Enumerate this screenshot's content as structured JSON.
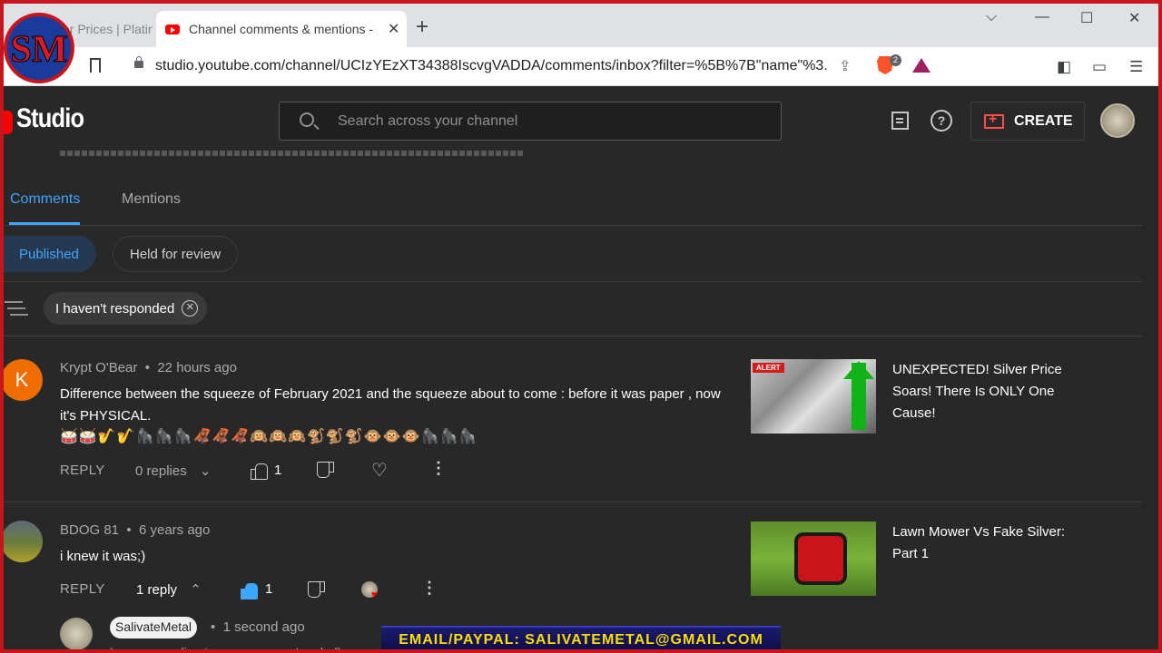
{
  "browser": {
    "inactive_tab": "ver Prices | Platin",
    "active_tab": "Channel comments & mentions -",
    "url": "studio.youtube.com/channel/UCIzYEzXT34388IscvgVADDA/comments/inbox?filter=%5B%7B\"name\"%3...",
    "brave_badge": "2"
  },
  "header": {
    "brand": "Studio",
    "search_placeholder": "Search across your channel",
    "create_label": "CREATE",
    "help_glyph": "?"
  },
  "tabs": [
    {
      "label": "Comments",
      "active": true
    },
    {
      "label": "Mentions",
      "active": false
    }
  ],
  "chips": {
    "published": "Published",
    "held": "Held for review"
  },
  "filter": {
    "label": "I haven't responded"
  },
  "comments": [
    {
      "avatar_letter": "K",
      "author": "Krypt O'Bear",
      "time": "22 hours ago",
      "text": "Difference between the squeeze of February 2021 and the squeeze about to come : before it was paper , now it's PHYSICAL.",
      "emojis": "🥁🥁🎷🎷🦍🦍🦍🦧🦧🦧🙉🙉🙉🐒🐒🐒🐵🐵🐵🦍🦍🦍",
      "reply_label": "REPLY",
      "replies": "0 replies",
      "likes": "1",
      "video_title": "UNEXPECTED! Silver Price Soars! There Is ONLY One Cause!",
      "thumb_badge": "ALERT"
    },
    {
      "author": "BDOG 81",
      "time": "6 years ago",
      "text": "i knew it was;)",
      "reply_label": "REPLY",
      "replies": "1 reply",
      "likes": "1",
      "video_title": "Lawn Mower Vs Fake Silver: Part 1"
    }
  ],
  "reply": {
    "author": "SalivateMetal",
    "time": "1 second ago",
    "text": "I am responding to your comment verbally on"
  },
  "overlay": {
    "banner": "EMAIL/PAYPAL: SALIVATEMETAL@GMAIL.COM",
    "logo_text": "SM"
  },
  "colors": {
    "accent_blue": "#3ea6ff",
    "brand_red": "#ff0000",
    "frame_red": "#c4161c"
  }
}
